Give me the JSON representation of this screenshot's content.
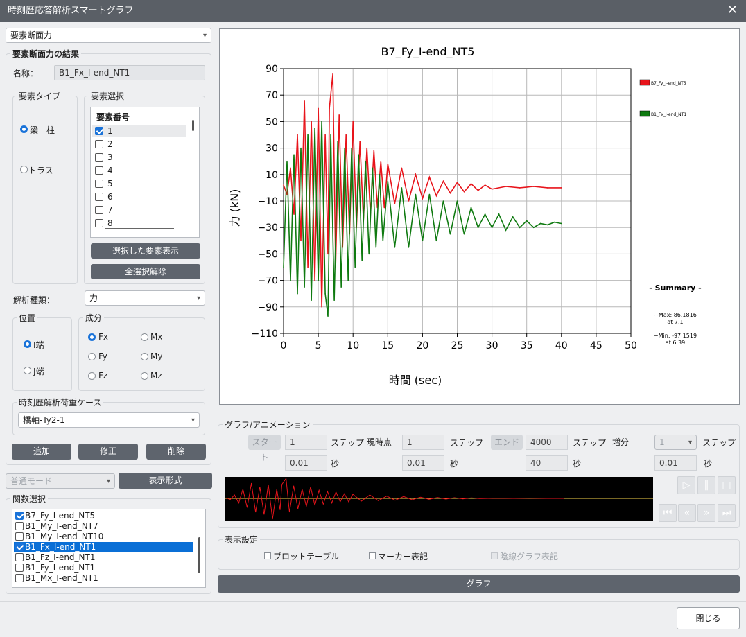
{
  "window": {
    "title": "時刻歴応答解析スマートグラフ"
  },
  "left": {
    "mode_select": "要素断面力",
    "results_group": "要素断面力の結果",
    "name_label": "名称：",
    "name_value": "B1_Fx_I-end_NT1",
    "elem_type_group": "要素タイプ",
    "elem_type_options": [
      "梁－柱",
      "トラス"
    ],
    "elem_select_group": "要素選択",
    "elem_list_header": "要素番号",
    "elem_list": [
      {
        "label": "1",
        "checked": true
      },
      {
        "label": "2",
        "checked": false
      },
      {
        "label": "3",
        "checked": false
      },
      {
        "label": "4",
        "checked": false
      },
      {
        "label": "5",
        "checked": false
      },
      {
        "label": "6",
        "checked": false
      },
      {
        "label": "7",
        "checked": false
      },
      {
        "label": "8",
        "checked": false
      }
    ],
    "show_selected_btn": "選択した要素表示",
    "clear_all_btn": "全選択解除",
    "analysis_type_label": "解析種類：",
    "analysis_type_value": "力",
    "position_group": "位置",
    "position_options": [
      "I端",
      "J端"
    ],
    "component_group": "成分",
    "components": [
      "Fx",
      "Mx",
      "Fy",
      "My",
      "Fz",
      "Mz"
    ],
    "loadcase_group": "時刻歴解析荷重ケース",
    "loadcase_value": "橋軸-Ty2-1",
    "add_btn": "追加",
    "modify_btn": "修正",
    "delete_btn": "削除",
    "normal_mode": "普通モード",
    "display_format_btn": "表示形式",
    "func_group": "関数選択",
    "func_list": [
      {
        "label": "B7_Fy_I-end_NT5",
        "checked": true,
        "selected": false
      },
      {
        "label": "B1_My_I-end_NT7",
        "checked": false,
        "selected": false
      },
      {
        "label": "B1_My_I-end_NT10",
        "checked": false,
        "selected": false
      },
      {
        "label": "B1_Fx_I-end_NT1",
        "checked": true,
        "selected": true
      },
      {
        "label": "B1_Fz_I-end_NT1",
        "checked": false,
        "selected": false
      },
      {
        "label": "B1_Fy_I-end_NT1",
        "checked": false,
        "selected": false
      },
      {
        "label": "B1_Mx_I-end_NT1",
        "checked": false,
        "selected": false
      }
    ]
  },
  "graph": {
    "title": "B7_Fy_I-end_NT5",
    "xlabel": "時間 (sec)",
    "ylabel": "力 (kN)",
    "legend": [
      {
        "name": "B7_Fy_I-end_NT5",
        "color": "#e8141b"
      },
      {
        "name": "B1_Fx_I-end_NT1",
        "color": "#0f7a10"
      }
    ],
    "summary_title": "- Summary -",
    "summary_max": "~Max: 86.1816",
    "summary_max_at": "at 7.1",
    "summary_min": "~Min: -97.1519",
    "summary_min_at": "at 6.39"
  },
  "chart_data": {
    "type": "line",
    "title": "B7_Fy_I-end_NT5",
    "xlabel": "時間 (sec)",
    "ylabel": "力 (kN)",
    "xlim": [
      0,
      50
    ],
    "ylim": [
      -110,
      90
    ],
    "xticks": [
      "0",
      "5",
      "10",
      "15",
      "20",
      "25",
      "30",
      "35",
      "40",
      "45",
      "50"
    ],
    "yticks": [
      "90",
      "70",
      "50",
      "30",
      "10",
      "−10",
      "−30",
      "−50",
      "−70",
      "−90",
      "−110"
    ],
    "grid": true,
    "legend_position": "right",
    "series": [
      {
        "name": "B7_Fy_I-end_NT5",
        "color": "#e8141b",
        "x": [
          0,
          0.5,
          1,
          1.5,
          2,
          2.5,
          3,
          3.5,
          4,
          4.5,
          5,
          5.5,
          6,
          6.39,
          6.6,
          7.1,
          7.5,
          8,
          8.5,
          9,
          9.5,
          10,
          10.5,
          11,
          11.5,
          12,
          12.5,
          13,
          13.5,
          14,
          14.5,
          15,
          16,
          17,
          18,
          19,
          20,
          21,
          22,
          23,
          24,
          25,
          26,
          27,
          28,
          29,
          30,
          32,
          34,
          36,
          38,
          40
        ],
        "y": [
          2,
          -5,
          15,
          -20,
          40,
          -40,
          66,
          -60,
          50,
          -70,
          60,
          -90,
          40,
          -50,
          60,
          86,
          -60,
          55,
          -45,
          40,
          -35,
          50,
          -30,
          35,
          -25,
          30,
          -20,
          28,
          -15,
          20,
          -15,
          18,
          -12,
          15,
          -10,
          10,
          -8,
          8,
          -6,
          5,
          -4,
          4,
          -3,
          3,
          -2,
          2,
          -1,
          1,
          0,
          1,
          0,
          0
        ]
      },
      {
        "name": "B1_Fx_I-end_NT1",
        "color": "#0f7a10",
        "x": [
          0,
          0.5,
          1,
          1.5,
          2,
          2.5,
          3,
          3.5,
          4,
          4.5,
          5,
          5.5,
          6,
          6.39,
          6.8,
          7.3,
          7.8,
          8.3,
          8.8,
          9.3,
          9.8,
          10.3,
          10.8,
          11.3,
          11.8,
          12.3,
          12.8,
          13.3,
          13.8,
          14.3,
          15,
          16,
          17,
          18,
          19,
          20,
          21,
          22,
          23,
          24,
          25,
          26,
          27,
          28,
          29,
          30,
          31,
          32,
          33,
          34,
          35,
          36,
          37,
          38,
          39,
          40
        ],
        "y": [
          -60,
          20,
          -70,
          25,
          -80,
          30,
          -75,
          40,
          -85,
          45,
          -70,
          50,
          -80,
          -97,
          40,
          -85,
          35,
          -75,
          30,
          -70,
          30,
          -60,
          25,
          -55,
          20,
          -50,
          15,
          -45,
          10,
          -40,
          5,
          -45,
          0,
          -45,
          -5,
          -40,
          -5,
          -40,
          -10,
          -35,
          -10,
          -35,
          -15,
          -30,
          -20,
          -30,
          -20,
          -32,
          -22,
          -30,
          -25,
          -30,
          -27,
          -28,
          -26,
          -27
        ]
      }
    ]
  },
  "animation": {
    "group": "グラフ/アニメーション",
    "start_btn": "スタート",
    "start_step": "1",
    "step_label": "ステップ",
    "current_label": "現時点",
    "current_step": "1",
    "end_btn": "エンド",
    "end_step": "4000",
    "increment_label": "増分",
    "increment_value": "1",
    "start_sec": "0.01",
    "current_sec": "0.01",
    "end_sec": "40",
    "inc_sec": "0.01",
    "sec_label": "秒"
  },
  "display": {
    "group": "表示設定",
    "plot_table": "プロットテーブル",
    "marker": "マーカー表記",
    "hidden_line": "陰線グラフ表記"
  },
  "graph_btn": "グラフ",
  "close_btn": "閉じる"
}
